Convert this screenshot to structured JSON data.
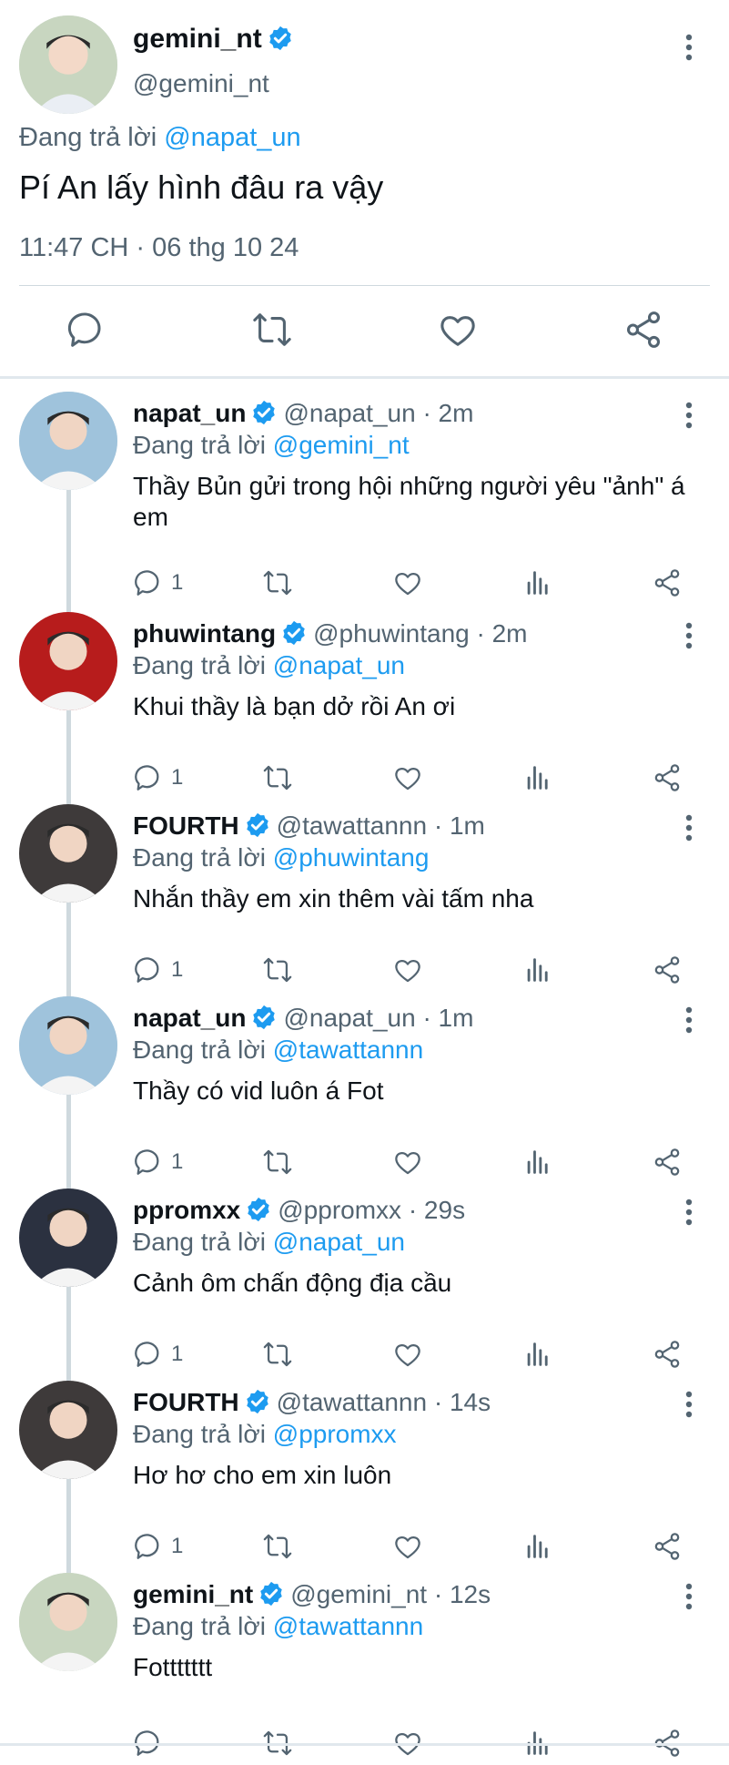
{
  "main_tweet": {
    "display_name": "gemini_nt",
    "handle": "@gemini_nt",
    "replying_prefix": "Đang trả lời",
    "replying_to": "@napat_un",
    "text": "Pí An lấy hình đâu ra vậy",
    "timestamp": "11:47 CH · 06 thg 10 24",
    "avatar_icon": "person-avatar",
    "actions": [
      "reply-icon",
      "retweet-icon",
      "like-icon",
      "share-icon"
    ]
  },
  "replies": [
    {
      "name": "napat_un",
      "meta": "@napat_un · 2m",
      "replying_prefix": "Đang trả lời",
      "replying_to": "@gemini_nt",
      "text": "Thầy Bủn gửi trong hội những người yêu \"ảnh\" á em",
      "reply_count": "1",
      "avatar_bg": "#9fc3dc"
    },
    {
      "name": "phuwintang",
      "meta": "@phuwintang · 2m",
      "replying_prefix": "Đang trả lời",
      "replying_to": "@napat_un",
      "text": "Khui thầy là bạn dở rồi An ơi",
      "reply_count": "1",
      "avatar_bg": "#b71c1c"
    },
    {
      "name": "FOURTH",
      "meta": "@tawattannn · 1m",
      "replying_prefix": "Đang trả lời",
      "replying_to": "@phuwintang",
      "text": "Nhắn thầy em xin thêm vài tấm nha",
      "reply_count": "1",
      "avatar_bg": "#3e3a3a"
    },
    {
      "name": "napat_un",
      "meta": "@napat_un · 1m",
      "replying_prefix": "Đang trả lời",
      "replying_to": "@tawattannn",
      "text": "Thầy có vid luôn á Fot",
      "reply_count": "1",
      "avatar_bg": "#9fc3dc"
    },
    {
      "name": "ppromxx",
      "meta": "@ppromxx · 29s",
      "replying_prefix": "Đang trả lời",
      "replying_to": "@napat_un",
      "text": "Cảnh ôm chấn động địa cầu",
      "reply_count": "1",
      "avatar_bg": "#2b3140"
    },
    {
      "name": "FOURTH",
      "meta": "@tawattannn · 14s",
      "replying_prefix": "Đang trả lời",
      "replying_to": "@ppromxx",
      "text": "Hơ hơ cho em xin luôn",
      "reply_count": "1",
      "avatar_bg": "#3e3a3a"
    },
    {
      "name": "gemini_nt",
      "meta": "@gemini_nt · 12s",
      "replying_prefix": "Đang trả lời",
      "replying_to": "@tawattannn",
      "text": "Fottttttt",
      "reply_count": "",
      "avatar_bg": "#c8d6c0"
    }
  ],
  "colors": {
    "link": "#1d9bf0",
    "verified": "#1d9bf0",
    "muted": "#536471",
    "text": "#0f1419"
  }
}
